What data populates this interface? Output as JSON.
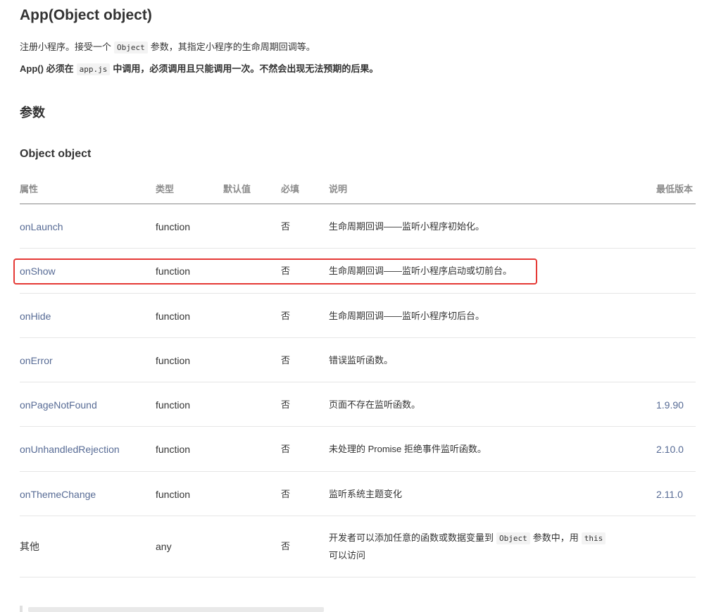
{
  "title": "App(Object object)",
  "intro": {
    "pre": "注册小程序。接受一个",
    "code": "Object",
    "post": "参数，其指定小程序的生命周期回调等。"
  },
  "note": {
    "pre": "App()",
    "mid1": "必须在",
    "code": "app.js",
    "post": "中调用，必须调用且只能调用一次。不然会出现无法预期的后果。"
  },
  "params_heading": "参数",
  "object_heading": "Object object",
  "table": {
    "headers": {
      "attr": "属性",
      "type": "类型",
      "default": "默认值",
      "required": "必填",
      "desc": "说明",
      "version": "最低版本"
    },
    "rows": [
      {
        "name": "onLaunch",
        "type": "function",
        "default": "",
        "required": "否",
        "desc": "生命周期回调——监听小程序初始化。",
        "version": ""
      },
      {
        "name": "onShow",
        "type": "function",
        "default": "",
        "required": "否",
        "desc": "生命周期回调——监听小程序启动或切前台。",
        "version": ""
      },
      {
        "name": "onHide",
        "type": "function",
        "default": "",
        "required": "否",
        "desc": "生命周期回调——监听小程序切后台。",
        "version": ""
      },
      {
        "name": "onError",
        "type": "function",
        "default": "",
        "required": "否",
        "desc": "错误监听函数。",
        "version": ""
      },
      {
        "name": "onPageNotFound",
        "type": "function",
        "default": "",
        "required": "否",
        "desc": "页面不存在监听函数。",
        "version": "1.9.90"
      },
      {
        "name": "onUnhandledRejection",
        "type": "function",
        "default": "",
        "required": "否",
        "desc": "未处理的 Promise 拒绝事件监听函数。",
        "version": "2.10.0"
      },
      {
        "name": "onThemeChange",
        "type": "function",
        "default": "",
        "required": "否",
        "desc": "监听系统主题变化",
        "version": "2.11.0"
      }
    ],
    "other_row": {
      "name": "其他",
      "type": "any",
      "required": "否",
      "desc_pre": "开发者可以添加任意的函数或数据变量到",
      "desc_code1": "Object",
      "desc_mid": "参数中，用",
      "desc_code2": "this",
      "desc_post": "可以访问"
    }
  },
  "colors": {
    "link": "#576b95",
    "highlight": "#e53935"
  }
}
